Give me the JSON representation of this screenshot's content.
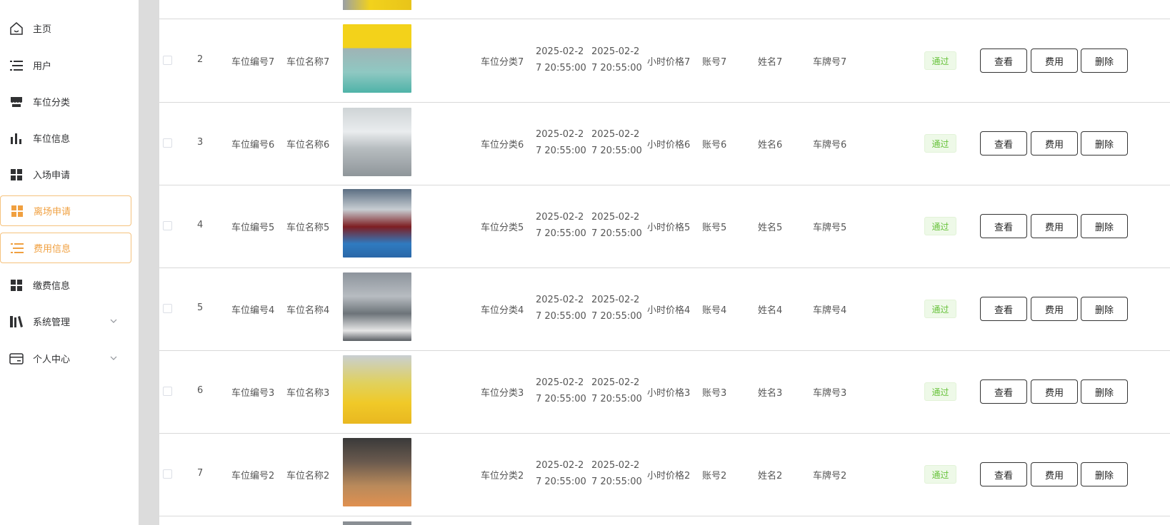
{
  "sidebar": {
    "items": [
      {
        "label": "主页",
        "icon": "home-icon",
        "active": false
      },
      {
        "label": "用户",
        "icon": "list-icon",
        "active": false
      },
      {
        "label": "车位分类",
        "icon": "store-icon",
        "active": false
      },
      {
        "label": "车位信息",
        "icon": "bar-chart-icon",
        "active": false
      },
      {
        "label": "入场申请",
        "icon": "grid-icon",
        "active": false
      },
      {
        "label": "离场申请",
        "icon": "grid-icon",
        "active": true
      },
      {
        "label": "费用信息",
        "icon": "list-icon",
        "active": true
      },
      {
        "label": "缴费信息",
        "icon": "grid-icon",
        "active": false
      },
      {
        "label": "系统管理",
        "icon": "library-icon",
        "active": false,
        "expandable": true
      },
      {
        "label": "个人中心",
        "icon": "card-icon",
        "active": false,
        "expandable": true
      }
    ]
  },
  "colors": {
    "accent": "#f0a040",
    "success": "#67c23a",
    "success_bg": "#eef9e8"
  },
  "table": {
    "rows": [
      {
        "index": "2",
        "spot_no": "车位编号7",
        "spot_name": "车位名称7",
        "category": "车位分类7",
        "start_time": "2025-02-27 20:55:00",
        "end_time": "2025-02-27 20:55:00",
        "hourly_price": "小时价格7",
        "account": "账号7",
        "name": "姓名7",
        "plate": "车牌号7",
        "status": "通过"
      },
      {
        "index": "3",
        "spot_no": "车位编号6",
        "spot_name": "车位名称6",
        "category": "车位分类6",
        "start_time": "2025-02-27 20:55:00",
        "end_time": "2025-02-27 20:55:00",
        "hourly_price": "小时价格6",
        "account": "账号6",
        "name": "姓名6",
        "plate": "车牌号6",
        "status": "通过"
      },
      {
        "index": "4",
        "spot_no": "车位编号5",
        "spot_name": "车位名称5",
        "category": "车位分类5",
        "start_time": "2025-02-27 20:55:00",
        "end_time": "2025-02-27 20:55:00",
        "hourly_price": "小时价格5",
        "account": "账号5",
        "name": "姓名5",
        "plate": "车牌号5",
        "status": "通过"
      },
      {
        "index": "5",
        "spot_no": "车位编号4",
        "spot_name": "车位名称4",
        "category": "车位分类4",
        "start_time": "2025-02-27 20:55:00",
        "end_time": "2025-02-27 20:55:00",
        "hourly_price": "小时价格4",
        "account": "账号4",
        "name": "姓名4",
        "plate": "车牌号4",
        "status": "通过"
      },
      {
        "index": "6",
        "spot_no": "车位编号3",
        "spot_name": "车位名称3",
        "category": "车位分类3",
        "start_time": "2025-02-27 20:55:00",
        "end_time": "2025-02-27 20:55:00",
        "hourly_price": "小时价格3",
        "account": "账号3",
        "name": "姓名3",
        "plate": "车牌号3",
        "status": "通过"
      },
      {
        "index": "7",
        "spot_no": "车位编号2",
        "spot_name": "车位名称2",
        "category": "车位分类2",
        "start_time": "2025-02-27 20:55:00",
        "end_time": "2025-02-27 20:55:00",
        "hourly_price": "小时价格2",
        "account": "账号2",
        "name": "姓名2",
        "plate": "车牌号2",
        "status": "通过"
      }
    ],
    "actions": {
      "view": "查看",
      "fee": "费用",
      "delete": "删除"
    }
  }
}
